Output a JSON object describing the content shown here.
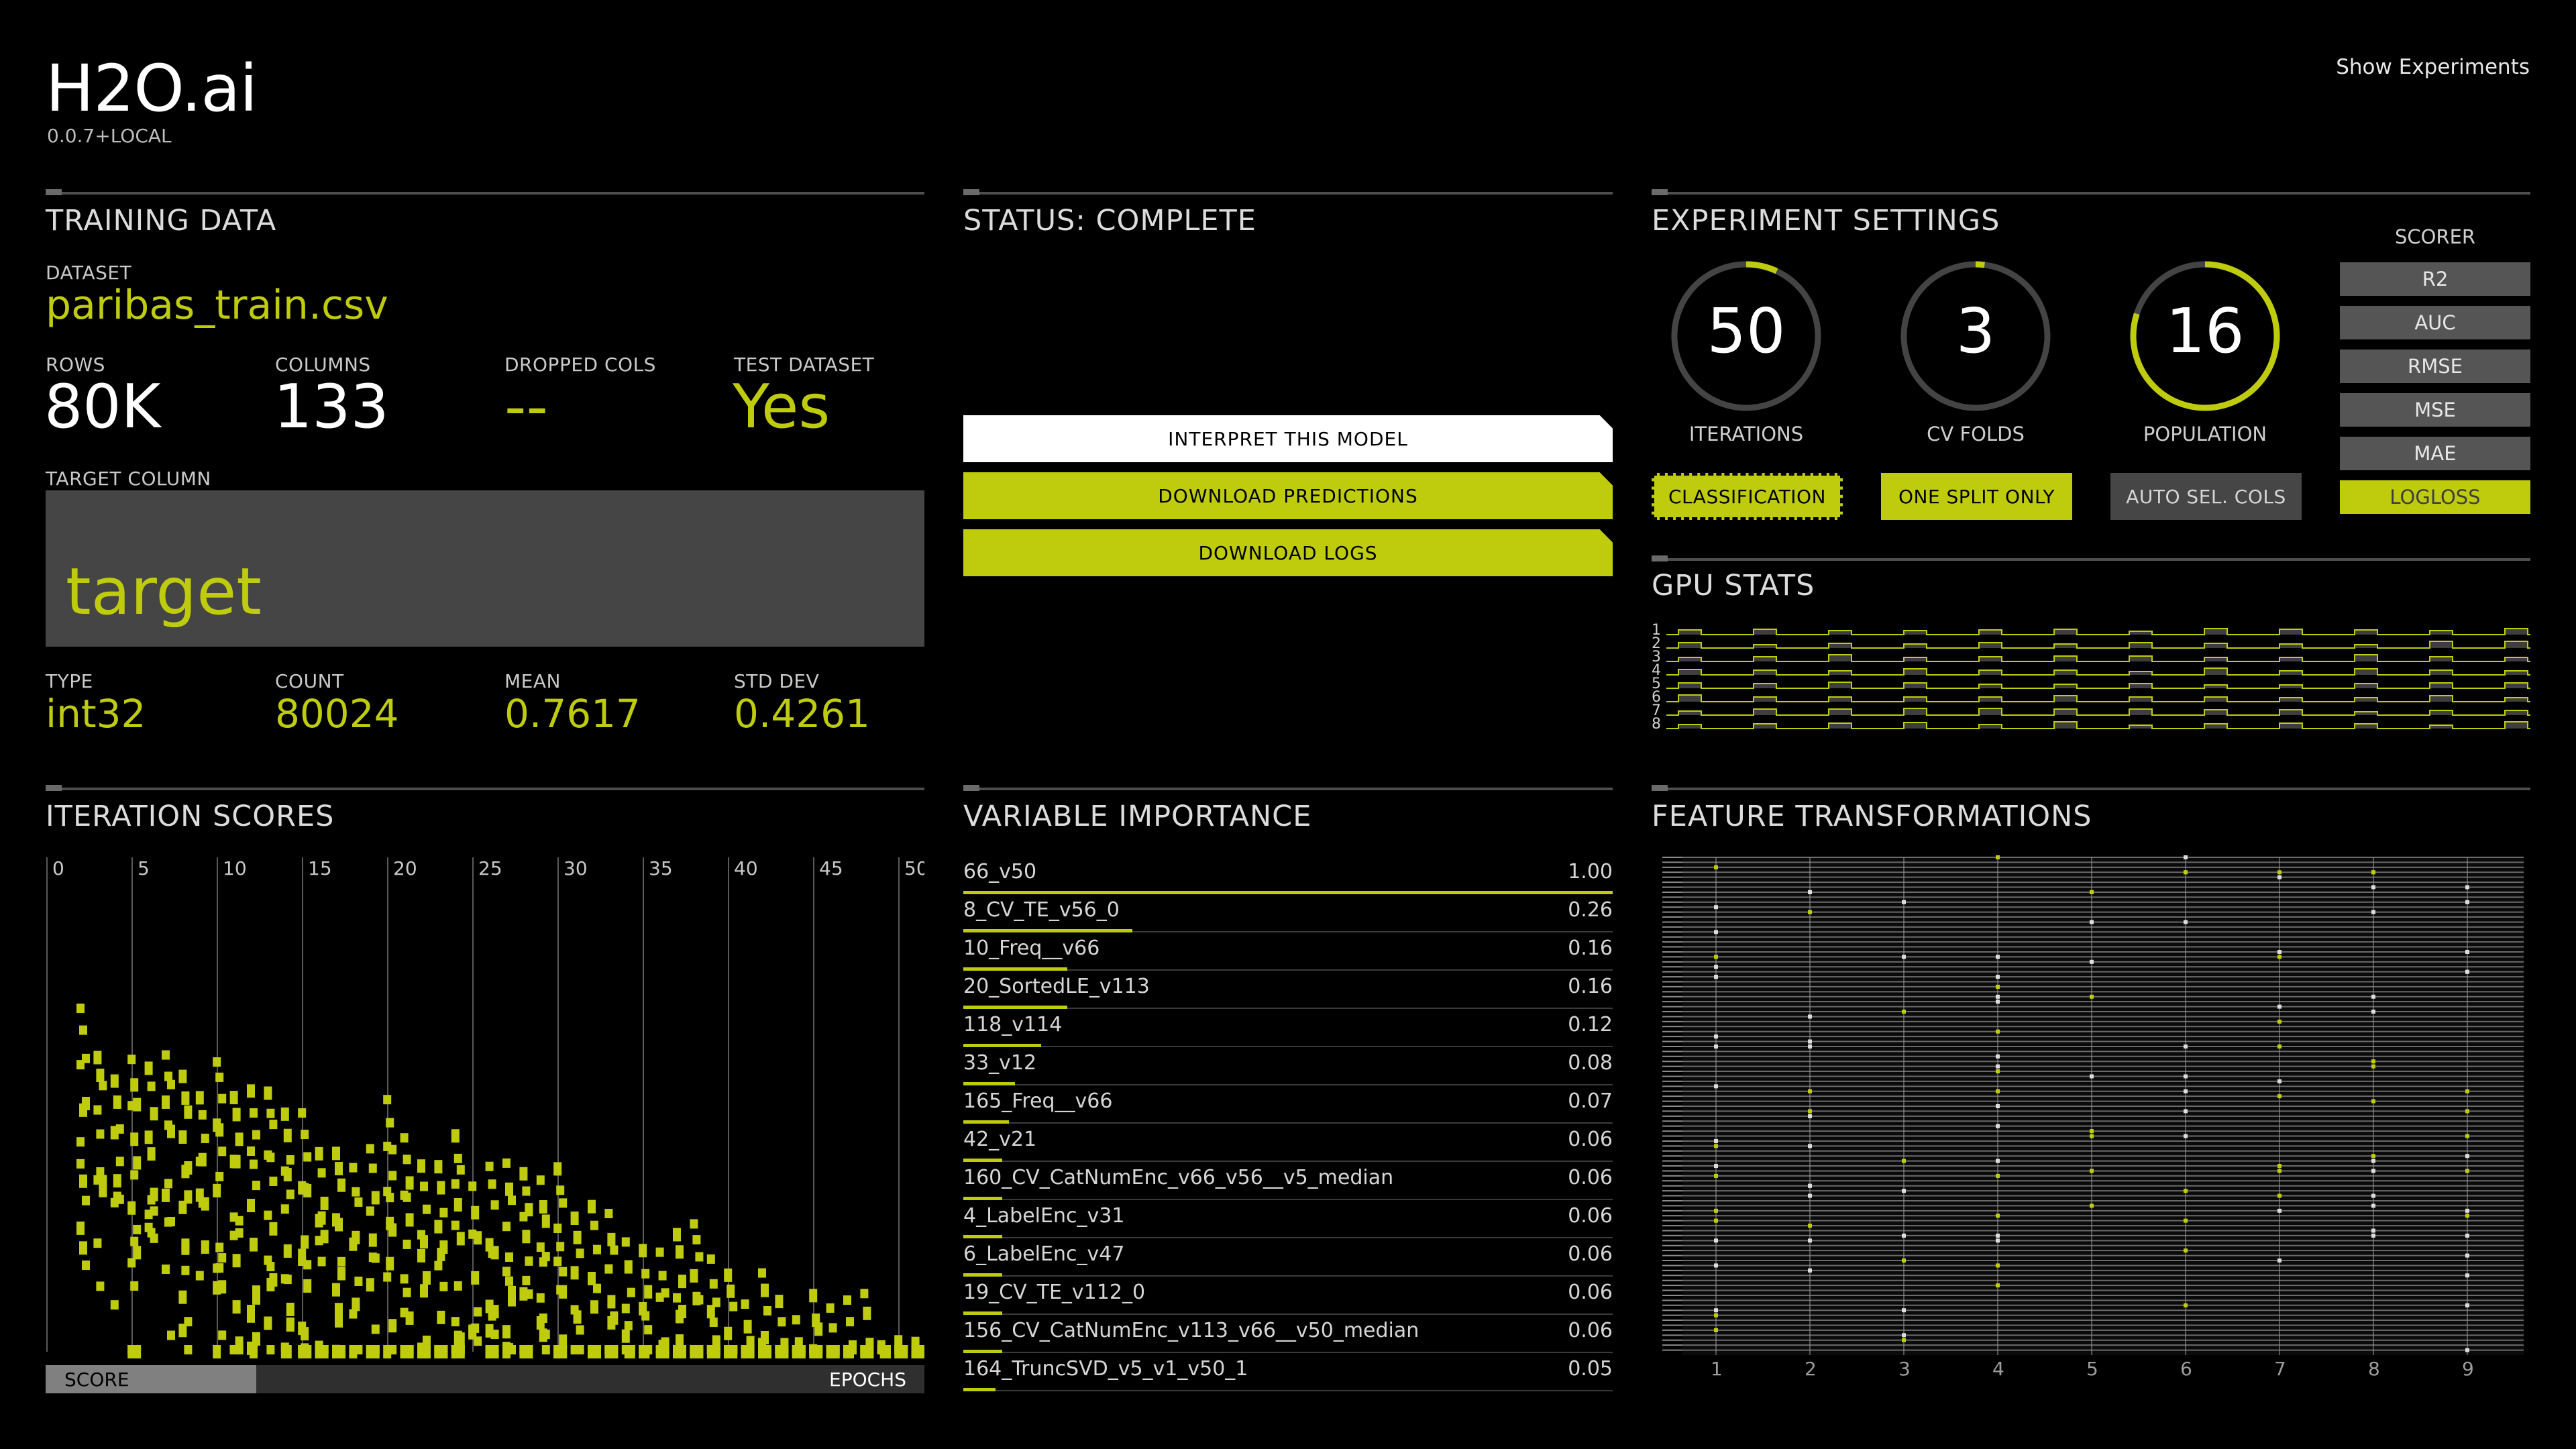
{
  "header": {
    "logo": "H2O.ai",
    "version": "0.0.7+LOCAL",
    "show_experiments": "Show Experiments"
  },
  "training_data": {
    "title": "TRAINING DATA",
    "dataset_label": "DATASET",
    "dataset": "paribas_train.csv",
    "stats": [
      {
        "label": "ROWS",
        "value": "80K"
      },
      {
        "label": "COLUMNS",
        "value": "133"
      },
      {
        "label": "DROPPED COLS",
        "value": "--"
      },
      {
        "label": "TEST DATASET",
        "value": "Yes"
      }
    ],
    "target_label": "TARGET COLUMN",
    "target": "target",
    "target_stats": [
      {
        "label": "TYPE",
        "value": "int32"
      },
      {
        "label": "COUNT",
        "value": "80024"
      },
      {
        "label": "MEAN",
        "value": "0.7617"
      },
      {
        "label": "STD DEV",
        "value": "0.4261"
      }
    ]
  },
  "status": {
    "title": "STATUS: COMPLETE",
    "buttons": [
      "INTERPRET THIS MODEL",
      "DOWNLOAD PREDICTIONS",
      "DOWNLOAD LOGS"
    ]
  },
  "settings": {
    "title": "EXPERIMENT SETTINGS",
    "gauges": [
      {
        "value": "50",
        "label": "ITERATIONS",
        "fraction": 0.07
      },
      {
        "value": "3",
        "label": "CV FOLDS",
        "fraction": 0.02
      },
      {
        "value": "16",
        "label": "POPULATION",
        "fraction": 0.8
      }
    ],
    "modes": [
      {
        "label": "CLASSIFICATION",
        "active": true
      },
      {
        "label": "ONE SPLIT ONLY",
        "active": true
      },
      {
        "label": "AUTO SEL. COLS",
        "active": false
      }
    ],
    "scorer_title": "SCORER",
    "scorers": [
      {
        "label": "R2",
        "active": false
      },
      {
        "label": "AUC",
        "active": false
      },
      {
        "label": "RMSE",
        "active": false
      },
      {
        "label": "MSE",
        "active": false
      },
      {
        "label": "MAE",
        "active": false
      },
      {
        "label": "LOGLOSS",
        "active": true
      }
    ]
  },
  "gpu": {
    "title": "GPU STATS",
    "rows": [
      "1",
      "2",
      "3",
      "4",
      "5",
      "6",
      "7",
      "8"
    ]
  },
  "iteration_scores": {
    "title": "ITERATION SCORES",
    "score_label": "SCORE",
    "epochs_label": "EPOCHS",
    "score_fraction": 0.24
  },
  "variable_importance": {
    "title": "VARIABLE IMPORTANCE",
    "items": [
      {
        "name": "66_v50",
        "value": "1.00",
        "fraction": 1.0
      },
      {
        "name": "8_CV_TE_v56_0",
        "value": "0.26",
        "fraction": 0.26
      },
      {
        "name": "10_Freq__v66",
        "value": "0.16",
        "fraction": 0.16
      },
      {
        "name": "20_SortedLE_v113",
        "value": "0.16",
        "fraction": 0.16
      },
      {
        "name": "118_v114",
        "value": "0.12",
        "fraction": 0.12
      },
      {
        "name": "33_v12",
        "value": "0.08",
        "fraction": 0.08
      },
      {
        "name": "165_Freq__v66",
        "value": "0.07",
        "fraction": 0.07
      },
      {
        "name": "42_v21",
        "value": "0.06",
        "fraction": 0.06
      },
      {
        "name": "160_CV_CatNumEnc_v66_v56__v5_median",
        "value": "0.06",
        "fraction": 0.06
      },
      {
        "name": "4_LabelEnc_v31",
        "value": "0.06",
        "fraction": 0.06
      },
      {
        "name": "6_LabelEnc_v47",
        "value": "0.06",
        "fraction": 0.06
      },
      {
        "name": "19_CV_TE_v112_0",
        "value": "0.06",
        "fraction": 0.06
      },
      {
        "name": "156_CV_CatNumEnc_v113_v66__v50_median",
        "value": "0.06",
        "fraction": 0.06
      },
      {
        "name": "164_TruncSVD_v5_v1_v50_1",
        "value": "0.05",
        "fraction": 0.05
      }
    ]
  },
  "feature_transformations": {
    "title": "FEATURE TRANSFORMATIONS"
  },
  "chart_data": [
    {
      "type": "scatter",
      "title": "ITERATION SCORES",
      "xlabel": "EPOCHS",
      "ylabel": "SCORE",
      "xlim": [
        0,
        50
      ],
      "x_ticks": [
        "0",
        "5",
        "10",
        "15",
        "20",
        "25",
        "30",
        "35",
        "40",
        "45",
        "50"
      ]
    },
    {
      "type": "scatter",
      "title": "FEATURE TRANSFORMATIONS",
      "x_ticks": [
        "1",
        "2",
        "3",
        "4",
        "5",
        "6",
        "7",
        "8",
        "9"
      ]
    }
  ],
  "colors": {
    "accent": "#bfcc0e",
    "background": "#000000",
    "panel_gray": "#454545"
  }
}
